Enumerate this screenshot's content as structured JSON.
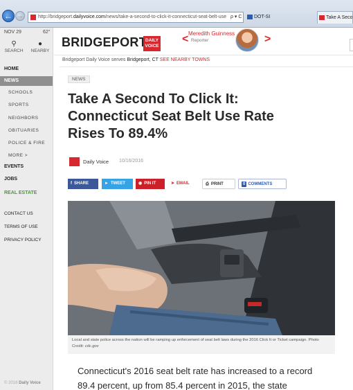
{
  "browser": {
    "url_prefix": "http://bridgeport.",
    "url_domain": "dailyvoice.com",
    "url_rest": "/news/take-a-second-to-click-it-connecticut-seat-belt-use",
    "addr_tools": "ρ ▾ C",
    "tabs": [
      {
        "label": "DOT-SI"
      },
      {
        "label": "Take A Seco"
      }
    ]
  },
  "sidebar": {
    "date": "NOV 29",
    "temp": "62°",
    "search_label": "SEARCH",
    "nearby_label": "NEARBY",
    "home_label": "HOME",
    "news_label": "NEWS",
    "sub_items": [
      "SCHOOLS",
      "SPORTS",
      "NEIGHBORS",
      "OBITUARIES",
      "POLICE & FIRE",
      "MORE  >"
    ],
    "events_label": "EVENTS",
    "jobs_label": "JOBS",
    "real_estate_label": "REAL ESTATE",
    "contact_label": "CONTACT US",
    "terms_label": "TERMS OF USE",
    "privacy_label": "PRIVACY POLICY",
    "footer_year": "© 2016",
    "footer_brand": "Daily Voice"
  },
  "header": {
    "site_name": "BRIDGEPORT",
    "logo_line1": "DAILY",
    "logo_line2": "VOICE",
    "reporter_name": "Meredith Guinness",
    "reporter_role": "Reporter",
    "prev_arrow": "<",
    "next_arrow": ">"
  },
  "serves": {
    "prefix": "Bridgeport Daily Voice serves",
    "town": "Bridgeport, CT",
    "nearby": "SEE NEARBY TOWNS"
  },
  "article": {
    "tag": "NEWS",
    "title": "Take A Second To Click It: Connecticut Seat Belt Use Rate Rises To 89.4%",
    "source": "Daily Voice",
    "date": "10/16/2016",
    "caption": "Local and state police across the nation will be ramping up enforcement of seat belt laws during the 2016 Click It or Ticket campaign.",
    "caption_credit_label": "Photo Credit:",
    "caption_credit": "cdc.gov",
    "body": "Connecticut's 2016 seat belt rate has increased to a record 89.4 percent, up from 85.4 percent in 2015, the state"
  },
  "share": {
    "facebook": "SHARE",
    "twitter": "TWEET",
    "pinterest": "PIN IT",
    "email": "EMAIL",
    "print": "PRINT",
    "comments_count": "0",
    "comments": "COMMENTS"
  },
  "colors": {
    "brand_red": "#d7282f",
    "facebook": "#3b5998",
    "twitter": "#36a3e6",
    "pinterest": "#cb2027",
    "real_estate_green": "#4a9a3a"
  }
}
